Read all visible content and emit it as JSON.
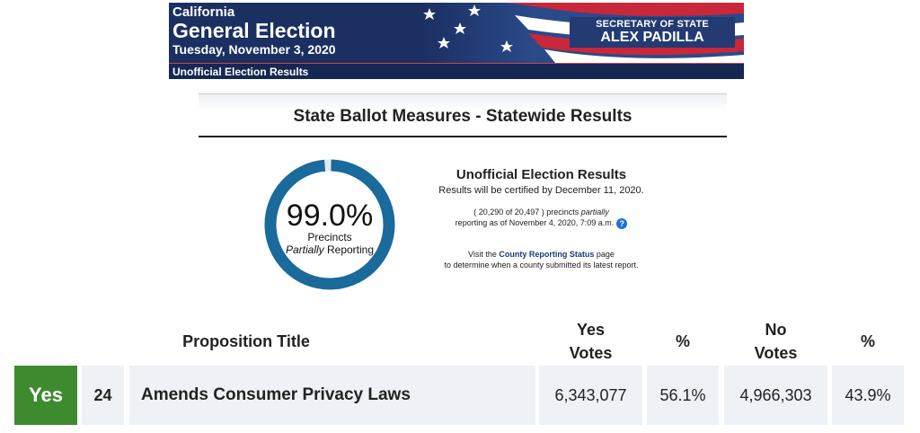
{
  "banner": {
    "state": "California",
    "election": "General Election",
    "date": "Tuesday, November 3, 2020",
    "unofficial": "Unofficial Election Results",
    "sos_title": "SECRETARY OF STATE",
    "sos_name": "ALEX PADILLA"
  },
  "page_title": "State Ballot Measures - Statewide Results",
  "donut": {
    "percent_label": "99.0%",
    "percent_value": 99.0,
    "line1": "Precincts",
    "line2_italic": "Partially",
    "line2_rest": " Reporting",
    "color": "#1a6a9b"
  },
  "info": {
    "title": "Unofficial Election Results",
    "certified": "Results will be certified by December 11, 2020.",
    "precincts_prefix": "( 20,290 of 20,497 ) precincts ",
    "precincts_italic": "partially",
    "precincts_suffix": "reporting as of November 4, 2020, 7:09 a.m.",
    "help_icon": "?",
    "visit_prefix": "Visit the ",
    "visit_link": "County Reporting Status",
    "visit_suffix": " page",
    "visit_line2": "to determine when a county submitted its latest report."
  },
  "table": {
    "headers": {
      "title": "Proposition Title",
      "yes_votes_1": "Yes",
      "yes_votes_2": "Votes",
      "yes_pct": "%",
      "no_votes_1": "No",
      "no_votes_2": "Votes",
      "no_pct": "%"
    },
    "rows": [
      {
        "result": "Yes",
        "number": "24",
        "title": "Amends Consumer Privacy Laws",
        "yes_votes": "6,343,077",
        "yes_pct": "56.1%",
        "no_votes": "4,966,303",
        "no_pct": "43.9%"
      }
    ]
  },
  "colors": {
    "banner_navy": "#1b2f61",
    "pass_green": "#3e8b2f",
    "donut_blue": "#1a6a9b",
    "link_navy": "#1b3a7a"
  }
}
